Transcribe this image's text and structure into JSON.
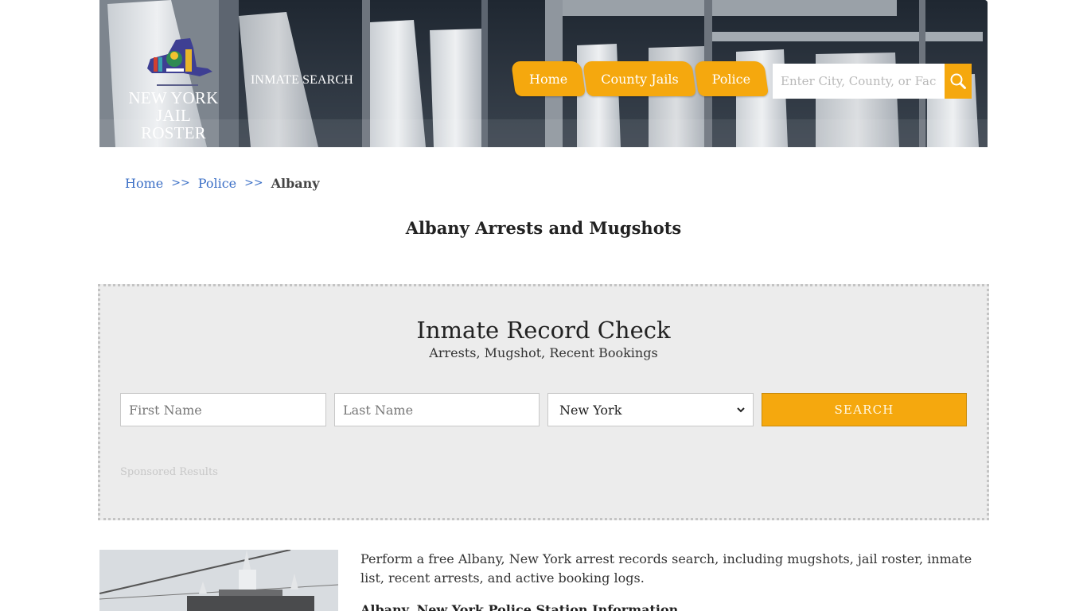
{
  "header": {
    "logo": {
      "line1": "NEW YORK",
      "line2": "JAIL ROSTER"
    },
    "tagline": "INMATE SEARCH",
    "nav": [
      {
        "label": "Home"
      },
      {
        "label": "County Jails"
      },
      {
        "label": "Police"
      }
    ],
    "search": {
      "placeholder": "Enter City, County, or Facility",
      "icon": "search-icon"
    }
  },
  "breadcrumb": {
    "items": [
      {
        "label": "Home"
      },
      {
        "label": "Police"
      }
    ],
    "separator": ">>",
    "current": "Albany"
  },
  "page_title": "Albany Arrests and Mugshots",
  "search_panel": {
    "title": "Inmate Record Check",
    "subtitle": "Arrests, Mugshot, Recent Bookings",
    "first_name_placeholder": "First Name",
    "last_name_placeholder": "Last Name",
    "state_selected": "New York",
    "submit_label": "SEARCH",
    "sponsored_label": "Sponsored Results"
  },
  "content": {
    "intro": "Perform a free Albany, New York arrest records search, including mugshots, jail roster, inmate list, recent arrests, and active booking logs.",
    "info_heading": "Albany, New York Police Station Information"
  },
  "colors": {
    "accent": "#f5a80e",
    "link": "#3b6fc6",
    "panel_bg": "#ececec"
  }
}
